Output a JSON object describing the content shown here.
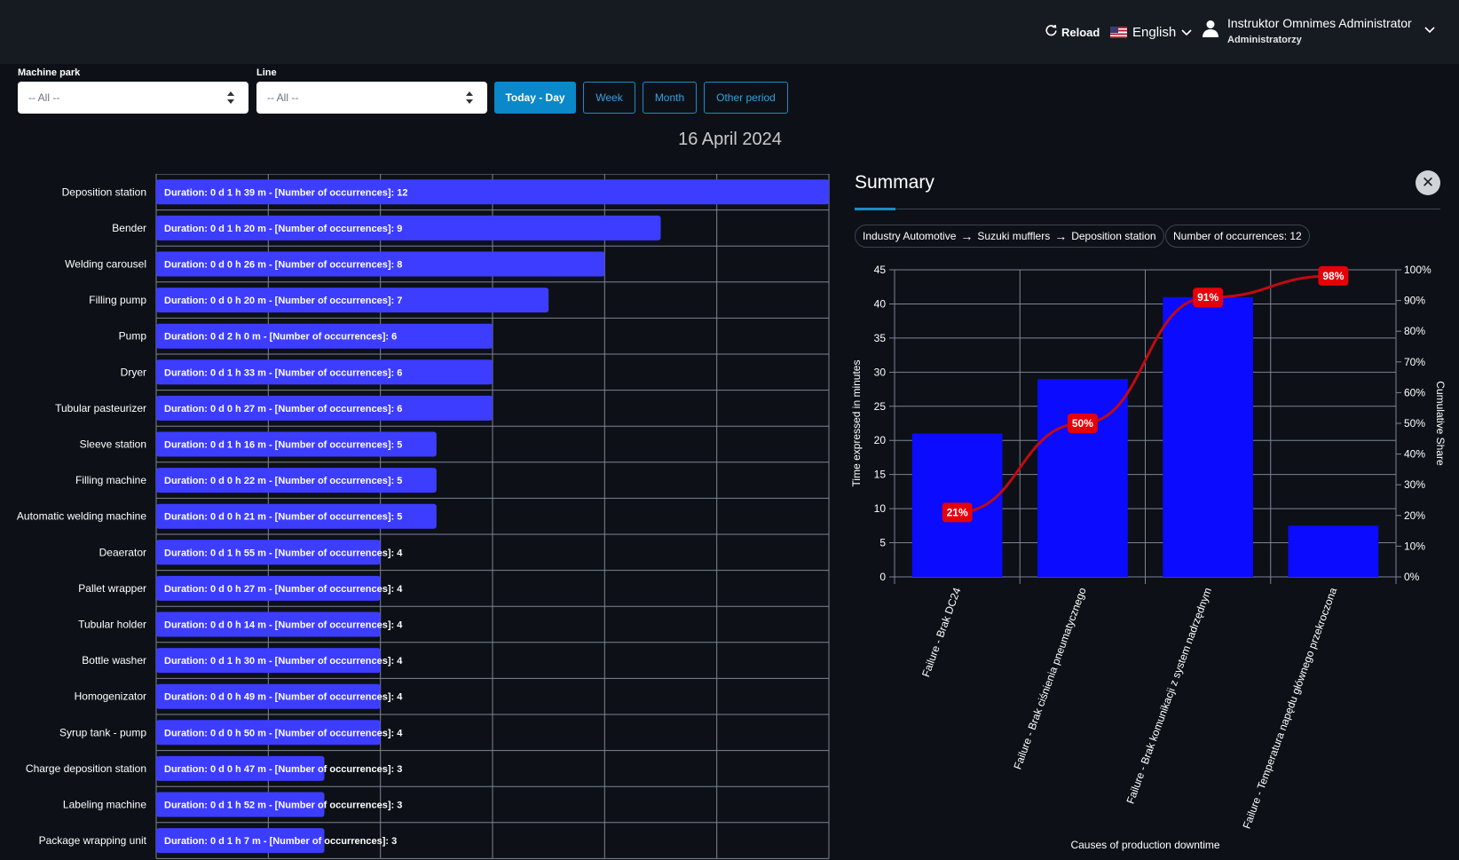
{
  "header": {
    "reload_label": "Reload",
    "language_label": "English",
    "user_name": "Instruktor Omnimes Administrator",
    "user_role": "Administratorzy"
  },
  "filters": {
    "machine_park_label": "Machine park",
    "machine_park_value": "-- All --",
    "line_label": "Line",
    "line_value": "-- All --"
  },
  "period_buttons": [
    "Today - Day",
    "Week",
    "Month",
    "Other period"
  ],
  "active_period": "Today - Day",
  "date_title": "16 April 2024",
  "colors": {
    "bar": "#3d3dff",
    "pareto_bar": "#0b0bff",
    "cumulative_line": "#c00a12",
    "label_bg": "#e6000a",
    "accent": "#0a88c9"
  },
  "summary": {
    "title": "Summary",
    "breadcrumb": [
      "Industry Automotive",
      "Suzuki mufflers",
      "Deposition station"
    ],
    "occurrences_label": "Number of occurrences: 12"
  },
  "chart_data": [
    {
      "type": "bar",
      "orientation": "horizontal",
      "categories": [
        "Deposition station",
        "Bender",
        "Welding carousel",
        "Filling pump",
        "Pump",
        "Dryer",
        "Tubular pasteurizer",
        "Sleeve station",
        "Filling machine",
        "Automatic welding machine",
        "Deaerator",
        "Pallet wrapper",
        "Tubular holder",
        "Bottle washer",
        "Homogenizator",
        "Syrup tank - pump",
        "Charge deposition station",
        "Labeling machine",
        "Package wrapping unit"
      ],
      "values": [
        12,
        9,
        8,
        7,
        6,
        6,
        6,
        5,
        5,
        5,
        4,
        4,
        4,
        4,
        4,
        4,
        3,
        3,
        3
      ],
      "data_labels": [
        "Duration: 0 d 1 h 39 m - [Number of occurrences]: 12",
        "Duration: 0 d 1 h 20 m - [Number of occurrences]: 9",
        "Duration: 0 d 0 h 26 m - [Number of occurrences]: 8",
        "Duration: 0 d 0 h 20 m - [Number of occurrences]: 7",
        "Duration: 0 d 2 h 0 m - [Number of occurrences]: 6",
        "Duration: 0 d 1 h 33 m - [Number of occurrences]: 6",
        "Duration: 0 d 0 h 27 m - [Number of occurrences]: 6",
        "Duration: 0 d 1 h 16 m - [Number of occurrences]: 5",
        "Duration: 0 d 0 h 22 m - [Number of occurrences]: 5",
        "Duration: 0 d 0 h 21 m - [Number of occurrences]: 5",
        "Duration: 0 d 1 h 55 m - [Number of occurrences]: 4",
        "Duration: 0 d 0 h 27 m - [Number of occurrences]: 4",
        "Duration: 0 d 0 h 14 m - [Number of occurrences]: 4",
        "Duration: 0 d 1 h 30 m - [Number of occurrences]: 4",
        "Duration: 0 d 0 h 49 m - [Number of occurrences]: 4",
        "Duration: 0 d 0 h 50 m - [Number of occurrences]: 4",
        "Duration: 0 d 0 h 47 m - [Number of occurrences]: 3",
        "Duration: 0 d 1 h 52 m - [Number of occurrences]: 3",
        "Duration: 0 d 1 h 7 m - [Number of occurrences]: 3"
      ],
      "xlim": [
        0,
        12
      ],
      "grid": true
    },
    {
      "type": "bar",
      "pareto": true,
      "categories": [
        "Failure - Brak DC24",
        "Failure - Brak ciśnienia pneumatycznego",
        "Failure - Brak komunikacji z system nadrzędnym",
        "Failure - Temperatura napędu głównego przekroczona"
      ],
      "values": [
        21,
        29,
        41,
        7.5
      ],
      "cumulative_percent": [
        21,
        50,
        91,
        98
      ],
      "cumulative_labels": [
        "21%",
        "50%",
        "91%",
        "98%"
      ],
      "xlabel": "Causes of production downtime",
      "ylabel": "Time expressed in minutes",
      "y2label": "Cumulative Share",
      "ylim": [
        0,
        45
      ],
      "y_ticks": [
        0,
        5,
        10,
        15,
        20,
        25,
        30,
        35,
        40,
        45
      ],
      "y2lim": [
        0,
        100
      ],
      "y2_ticks": [
        "0%",
        "10%",
        "20%",
        "30%",
        "40%",
        "50%",
        "60%",
        "70%",
        "80%",
        "90%",
        "100%"
      ],
      "grid": true
    }
  ]
}
